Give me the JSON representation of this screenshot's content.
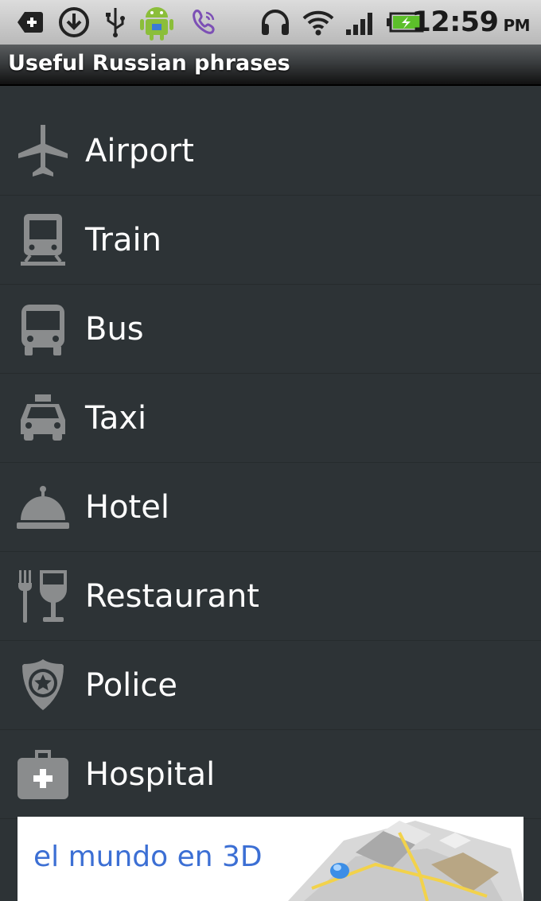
{
  "status_bar": {
    "time": "12:59",
    "ampm": "PM",
    "icons": [
      "add-notification-icon",
      "download-icon",
      "usb-icon",
      "android-icon",
      "viber-icon",
      "headphones-icon",
      "wifi-icon",
      "signal-icon",
      "battery-icon"
    ]
  },
  "title_bar": {
    "title": "Useful Russian phrases"
  },
  "menu": [
    {
      "label": "Airport",
      "icon": "airplane-icon"
    },
    {
      "label": "Train",
      "icon": "train-icon"
    },
    {
      "label": "Bus",
      "icon": "bus-icon"
    },
    {
      "label": "Taxi",
      "icon": "taxi-icon"
    },
    {
      "label": "Hotel",
      "icon": "bell-icon"
    },
    {
      "label": "Restaurant",
      "icon": "fork-wine-icon"
    },
    {
      "label": "Police",
      "icon": "badge-icon"
    },
    {
      "label": "Hospital",
      "icon": "first-aid-icon"
    }
  ],
  "ad": {
    "text": "el mundo en 3D"
  },
  "colors": {
    "background": "#2d3336",
    "icon": "#8a8c8d",
    "text": "#ffffff",
    "ad_text": "#3c6fd4"
  }
}
